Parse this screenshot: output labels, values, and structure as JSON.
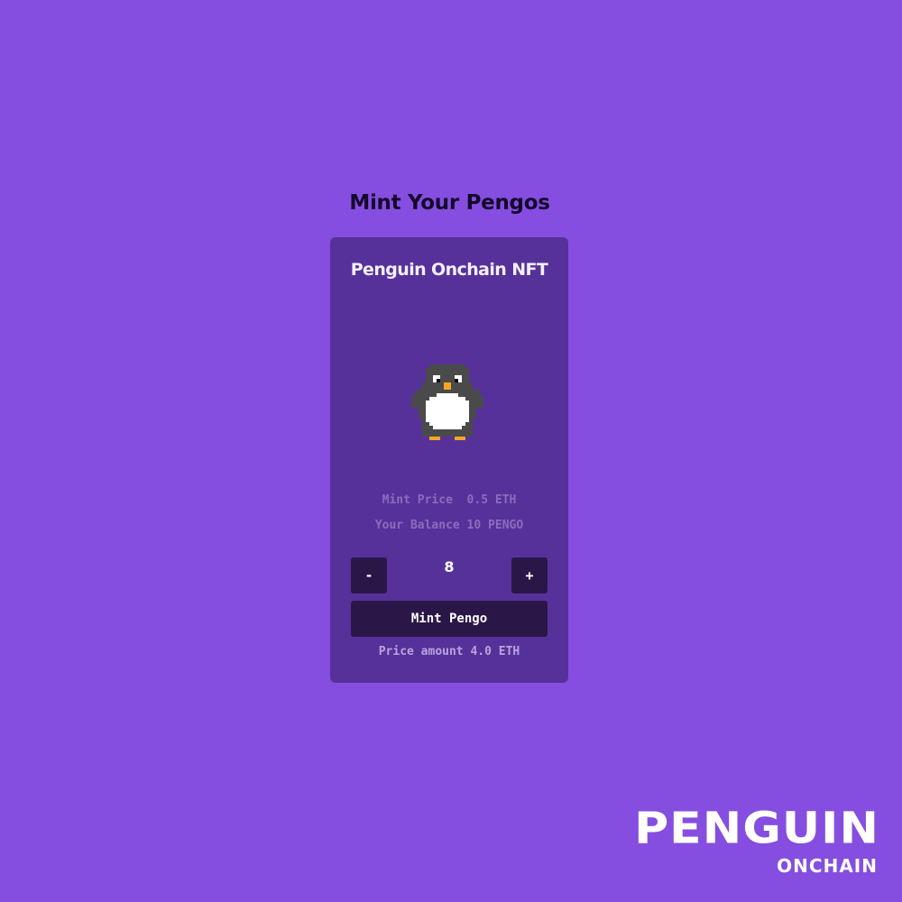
{
  "page": {
    "heading": "Mint Your Pengos",
    "background_color": "#854ee0"
  },
  "card": {
    "title": "Penguin Onchain NFT",
    "background_color": "#56319a",
    "image_icon": "pixel-penguin-icon",
    "mint_price_label": "Mint Price",
    "mint_price_value": "0.5 ETH",
    "mint_price_text": "Mint Price  0.5 ETH",
    "balance_text": "Your Balance 10 PENGO",
    "stepper": {
      "decrement_label": "-",
      "increment_label": "+",
      "quantity": "8"
    },
    "mint_button_label": "Mint Pengo",
    "price_amount_text": "Price amount 4.0 ETH",
    "button_color": "#2a1748"
  },
  "logo": {
    "main": "PENGUIN",
    "sub": "ONCHAIN"
  }
}
